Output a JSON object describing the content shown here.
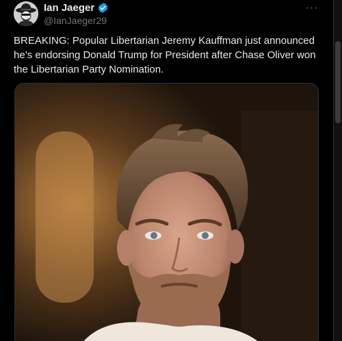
{
  "author": {
    "display_name": "Ian Jaeger",
    "handle": "@IanJaeger29",
    "verified": true,
    "avatar_icon": "cowboy-hat-avatar"
  },
  "post": {
    "text": "BREAKING: Popular Libertarian Jeremy Kauffman just announced he’s endorsing Donald Trump for President after Chase Oliver won the Libertarian Party Nomination.",
    "media_alt": "photo-of-man-with-beard"
  },
  "menu": {
    "icon": "more-options-icon",
    "glyph": "···"
  },
  "colors": {
    "background": "#000000",
    "text": "#e7e9ea",
    "secondary_text": "#71767b",
    "verified_blue": "#1d9bf0",
    "border": "#2f3336"
  }
}
